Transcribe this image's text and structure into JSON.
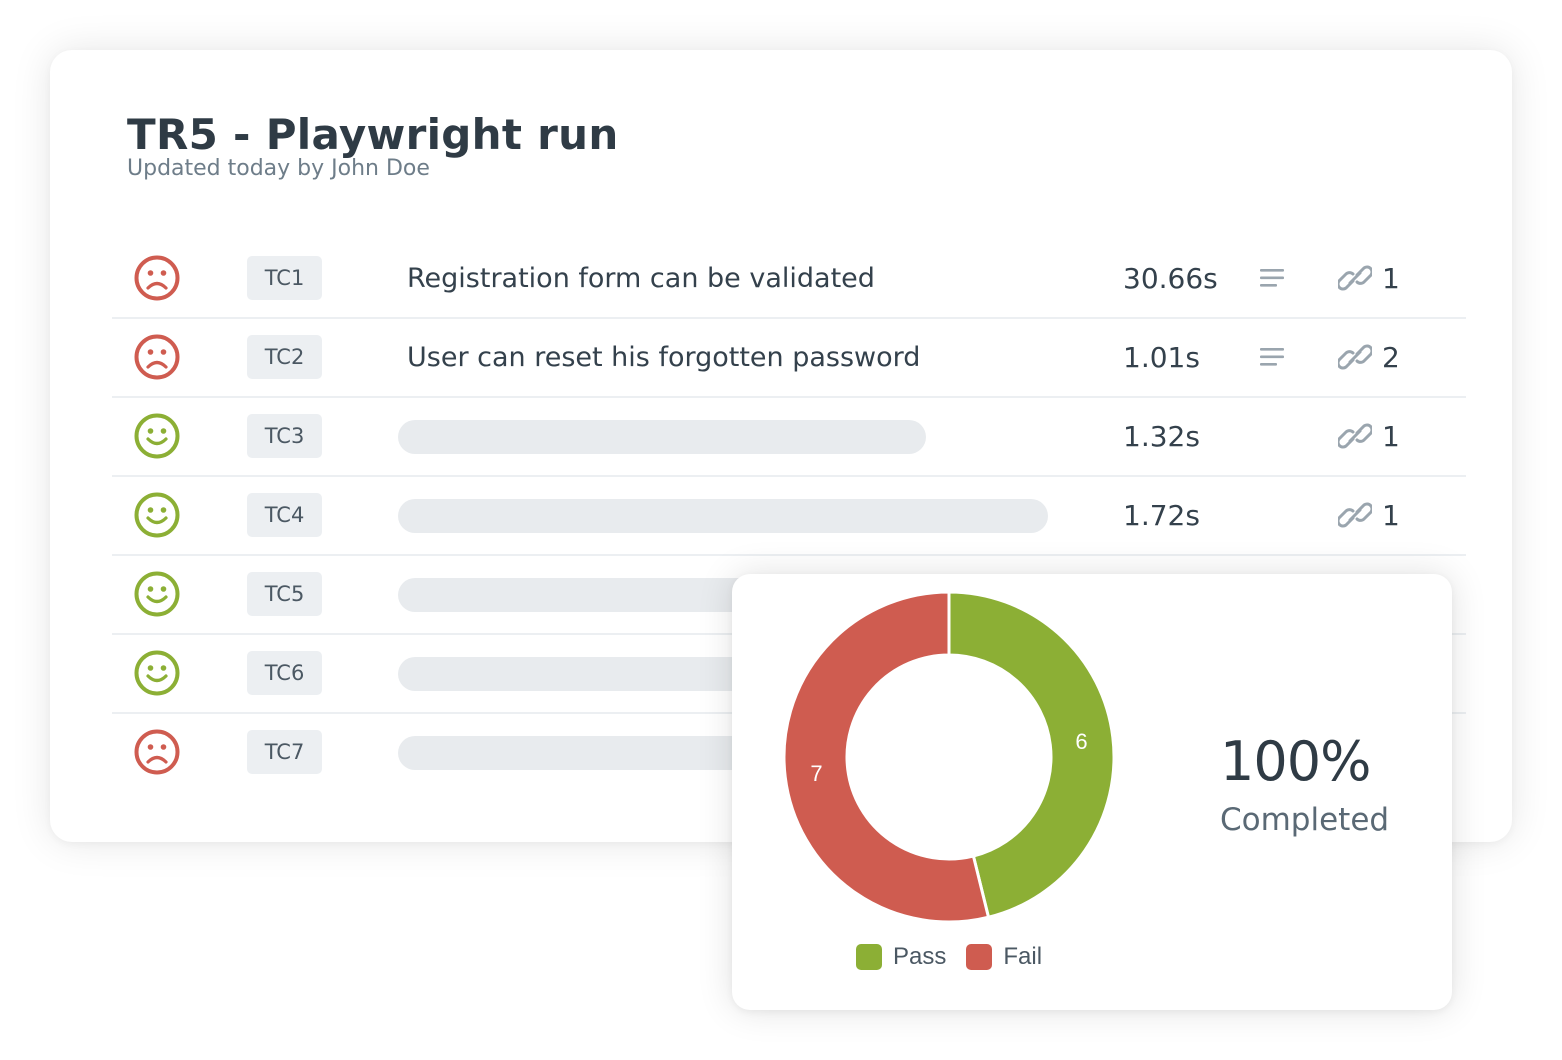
{
  "run": {
    "title": "TR5 - Playwright run",
    "subtitle": "Updated today by John Doe"
  },
  "colors": {
    "pass": "#8caf35",
    "fail": "#cf5c50"
  },
  "tests": [
    {
      "status": "fail",
      "icon": "sad-face-icon",
      "id": "TC1",
      "name": "Registration form can be validated",
      "duration": "30.66s",
      "has_notes": true,
      "links": "1"
    },
    {
      "status": "fail",
      "icon": "sad-face-icon",
      "id": "TC2",
      "name": "User can reset his forgotten password",
      "duration": "1.01s",
      "has_notes": true,
      "links": "2"
    },
    {
      "status": "pass",
      "icon": "happy-face-icon",
      "id": "TC3",
      "name": null,
      "duration": "1.32s",
      "has_notes": false,
      "links": "1"
    },
    {
      "status": "pass",
      "icon": "happy-face-icon",
      "id": "TC4",
      "name": null,
      "duration": "1.72s",
      "has_notes": false,
      "links": "1"
    },
    {
      "status": "pass",
      "icon": "happy-face-icon",
      "id": "TC5",
      "name": null
    },
    {
      "status": "pass",
      "icon": "happy-face-icon",
      "id": "TC6",
      "name": null
    },
    {
      "status": "fail",
      "icon": "sad-face-icon",
      "id": "TC7",
      "name": null
    }
  ],
  "summary": {
    "percent": "100%",
    "label": "Completed"
  },
  "chart_data": {
    "type": "pie",
    "categories": [
      "Pass",
      "Fail"
    ],
    "values": [
      6,
      7
    ],
    "colors": [
      "#8caf35",
      "#cf5c50"
    ],
    "legend_position": "bottom"
  }
}
